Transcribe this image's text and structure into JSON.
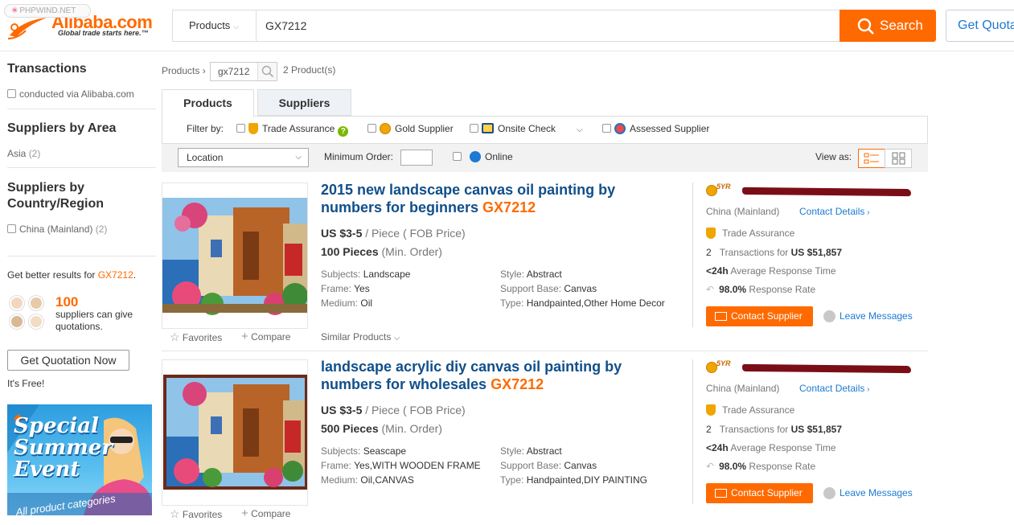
{
  "watermark": "PHPWIND.NET",
  "header": {
    "logo_name": "Alibaba.com",
    "logo_tagline": "Global trade starts here.",
    "trademark": "™",
    "search_category": "Products",
    "search_value": "GX7212",
    "search_button": "Search",
    "quote_button": "Get Quota"
  },
  "sidebar": {
    "transactions_title": "Transactions",
    "transactions_option": "conducted via Alibaba.com",
    "area_title": "Suppliers by Area",
    "area_option": "Asia",
    "area_count": "(2)",
    "country_title": "Suppliers by Country/Region",
    "country_option": "China (Mainland)",
    "country_count": "(2)",
    "better_prefix": "Get better results for ",
    "better_keyword": "GX7212",
    "better_suffix": ".",
    "suppliers_count": "100",
    "suppliers_text": "suppliers can give quotations.",
    "quote_button": "Get Quotation Now",
    "free_text": "It's Free!",
    "banner_line1": "Special",
    "banner_line2": "Summer",
    "banner_line3": "Event",
    "banner_line4": "All product categories"
  },
  "breadcrumb": {
    "root": "Products",
    "sep": "›",
    "keyword": "gx7212",
    "count": "2 Product(s)"
  },
  "tabs": [
    "Products",
    "Suppliers"
  ],
  "filter": {
    "label": "Filter by:",
    "trade_assurance": "Trade Assurance",
    "gold_supplier": "Gold Supplier",
    "onsite_check": "Onsite Check",
    "assessed_supplier": "Assessed Supplier"
  },
  "options": {
    "location": "Location",
    "min_order": "Minimum Order:",
    "online": "Online",
    "view_as": "View as:"
  },
  "products": [
    {
      "title": "2015 new landscape canvas oil painting by numbers for beginners ",
      "keyword": "GX7212",
      "price": "US $3-5",
      "unit": " / Piece ( FOB Price)",
      "min_order": "100 Pieces",
      "min_order_note": " (Min. Order)",
      "attrs": {
        "subjects": "Landscape",
        "frame": "Yes",
        "medium": "Oil",
        "style": "Abstract",
        "support_base": "Canvas",
        "type": "Handpainted,Other Home Decor"
      },
      "supplier": {
        "years": "5YR",
        "country": "China (Mainland)",
        "contact_details": "Contact Details",
        "trade_assurance": "Trade Assurance",
        "transactions_count": "2",
        "transactions_text": "Transactions for ",
        "transactions_amount": "US $51,857",
        "response_time": "<24h",
        "response_time_text": " Average Response Time",
        "response_rate": "98.0%",
        "response_rate_text": " Response Rate",
        "contact_button": "Contact Supplier",
        "leave_messages": "Leave Messages"
      }
    },
    {
      "title": "landscape acrylic diy canvas oil painting by numbers for wholesales ",
      "keyword": "GX7212",
      "price": "US $3-5",
      "unit": " / Piece ( FOB Price)",
      "min_order": "500 Pieces",
      "min_order_note": " (Min. Order)",
      "attrs": {
        "subjects": "Seascape",
        "frame": "Yes,WITH WOODEN FRAME",
        "medium": "Oil,CANVAS",
        "style": "Abstract",
        "support_base": "Canvas",
        "type": "Handpainted,DIY PAINTING"
      },
      "supplier": {
        "years": "5YR",
        "country": "China (Mainland)",
        "contact_details": "Contact Details",
        "trade_assurance": "Trade Assurance",
        "transactions_count": "2",
        "transactions_text": "Transactions for ",
        "transactions_amount": "US $51,857",
        "response_time": "<24h",
        "response_time_text": " Average Response Time",
        "response_rate": "98.0%",
        "response_rate_text": " Response Rate",
        "contact_button": "Contact Supplier",
        "leave_messages": "Leave Messages"
      }
    }
  ],
  "labels": {
    "subjects": "Subjects: ",
    "frame": "Frame: ",
    "medium": "Medium: ",
    "style": "Style: ",
    "support_base": "Support Base: ",
    "type": "Type: ",
    "favorites": "Favorites",
    "compare": "Compare",
    "similar_products": "Similar Products"
  },
  "colors": {
    "brand_orange": "#ff6a00",
    "title_blue": "#114f8a",
    "link_blue": "#1c7ad2"
  }
}
